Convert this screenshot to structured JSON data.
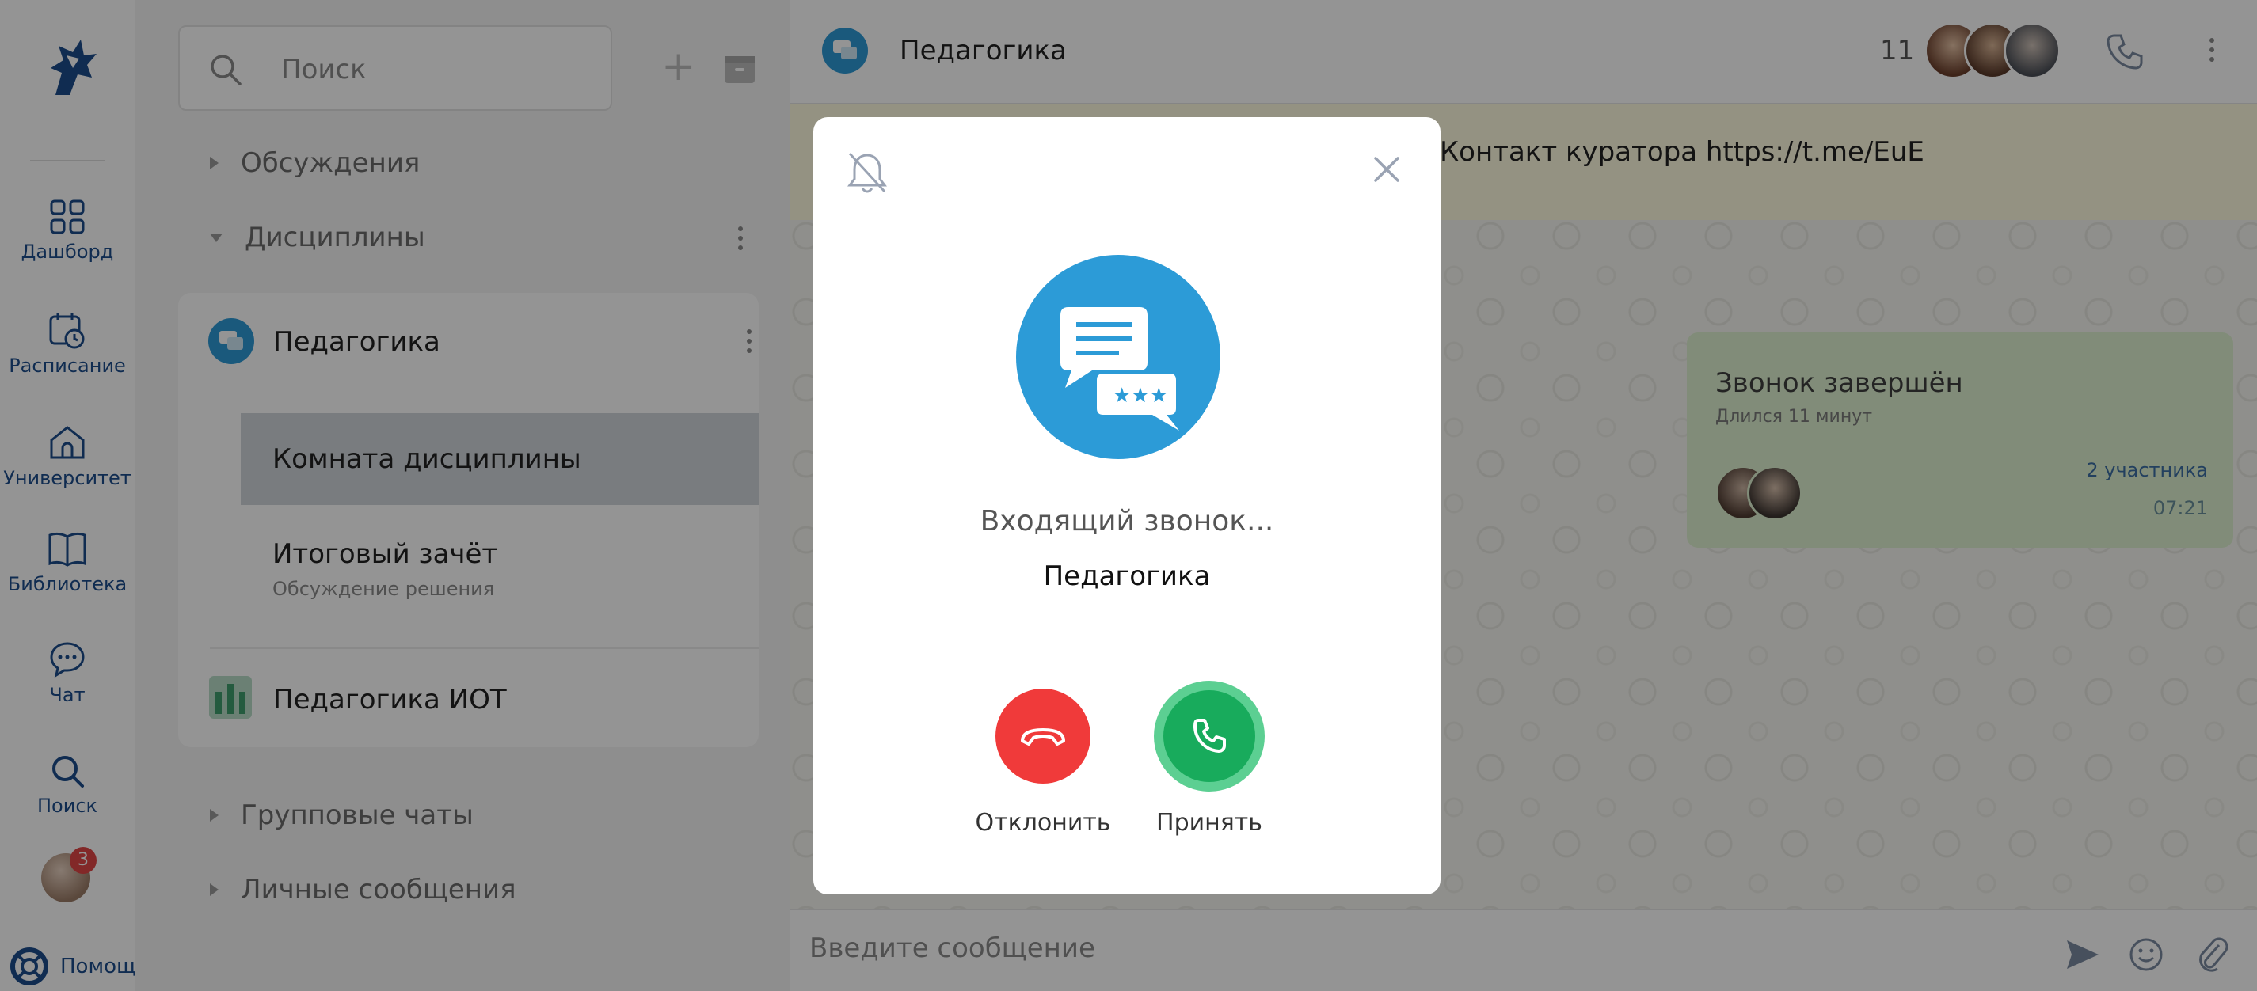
{
  "nav": {
    "items": [
      {
        "label": "Дашборд",
        "icon": "dashboard-icon"
      },
      {
        "label": "Расписание",
        "icon": "schedule-icon"
      },
      {
        "label": "Университет",
        "icon": "university-icon"
      },
      {
        "label": "Библиотека",
        "icon": "library-icon"
      },
      {
        "label": "Чат",
        "icon": "chat-icon"
      },
      {
        "label": "Поиск",
        "icon": "search-icon"
      }
    ],
    "profile_badge": "3",
    "help_label": "Помощь"
  },
  "chat_list": {
    "search_placeholder": "Поиск",
    "sections": {
      "discussions": "Обсуждения",
      "disciplines": "Дисциплины",
      "group_chats": "Групповые чаты",
      "personal": "Личные сообщения"
    },
    "discipline": {
      "title": "Педагогика",
      "rooms": [
        {
          "title": "Комната дисциплины"
        },
        {
          "title": "Итоговый зачёт",
          "subtitle": "Обсуждение решения"
        }
      ]
    },
    "other_chat": "Педагогика ИОТ"
  },
  "chat": {
    "title": "Педагогика",
    "participants_count": "11",
    "pinned_text": "Контакт куратора https://t.me/EuE",
    "call_bubble": {
      "title": "Звонок завершён",
      "duration": "Длился 11 минут",
      "participants": "2 участника",
      "time": "07:21"
    },
    "composer_placeholder": "Введите сообщение"
  },
  "call_modal": {
    "status": "Входящий звонок...",
    "caller": "Педагогика",
    "decline_label": "Отклонить",
    "accept_label": "Принять"
  },
  "colors": {
    "brand": "#1c4d8c",
    "chat_icon": "#2e9ad6",
    "decline": "#f03a3a",
    "accept": "#18ab5c",
    "pinned_bg": "#fffbe0",
    "bubble_bg": "#def2d0"
  }
}
